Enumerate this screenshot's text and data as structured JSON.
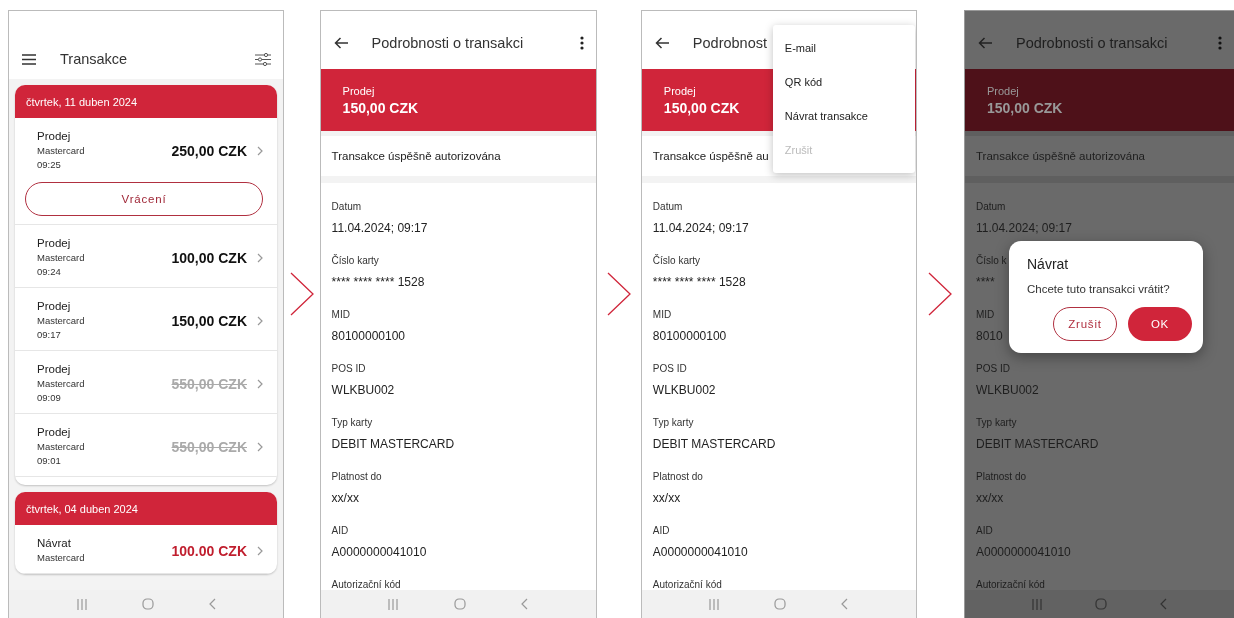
{
  "screens": [
    {
      "kind": "list",
      "title": "Transakce",
      "groups": [
        {
          "date": "čtvrtek, 11 duben 2024",
          "items": [
            {
              "type": "Prodej",
              "card": "Mastercard",
              "time": "09:25",
              "amount": "250,00 CZK",
              "kind": "sale",
              "voided": false,
              "action": "Vrácení"
            },
            {
              "type": "Prodej",
              "card": "Mastercard",
              "time": "09:24",
              "amount": "100,00 CZK",
              "kind": "sale",
              "voided": false
            },
            {
              "type": "Prodej",
              "card": "Mastercard",
              "time": "09:17",
              "amount": "150,00 CZK",
              "kind": "sale",
              "voided": false
            },
            {
              "type": "Prodej",
              "card": "Mastercard",
              "time": "09:09",
              "amount": "550,00 CZK",
              "kind": "sale",
              "voided": true
            },
            {
              "type": "Prodej",
              "card": "Mastercard",
              "time": "09:01",
              "amount": "550,00 CZK",
              "kind": "sale",
              "voided": true
            }
          ]
        },
        {
          "date": "čtvrtek, 04 duben 2024",
          "items": [
            {
              "type": "Návrat",
              "card": "Mastercard",
              "amount": "100.00 CZK",
              "kind": "refund",
              "voided": false
            }
          ]
        }
      ]
    },
    {
      "kind": "detail",
      "title": "Podrobnosti o transakci",
      "dimmed": false,
      "banner": {
        "type": "Prodej",
        "amount": "150,00 CZK"
      },
      "status": "Transakce úspěšně autorizována",
      "fields": [
        {
          "label": "Datum",
          "value": "11.04.2024; 09:17"
        },
        {
          "label": "Číslo karty",
          "value": "**** **** **** 1528"
        },
        {
          "label": "MID",
          "value": "80100000100"
        },
        {
          "label": "POS ID",
          "value": "WLKBU002"
        },
        {
          "label": "Typ karty",
          "value": "DEBIT MASTERCARD"
        },
        {
          "label": "Platnost do",
          "value": "xx/xx"
        },
        {
          "label": "AID",
          "value": "A0000000041010"
        },
        {
          "label": "Autorizační kód"
        }
      ]
    },
    {
      "kind": "detail",
      "title": "Podrobnost",
      "dimmed": false,
      "banner": {
        "type": "Prodej",
        "amount": "150,00 CZK"
      },
      "status": "Transakce úspěšně au",
      "fields": [
        {
          "label": "Datum",
          "value": "11.04.2024; 09:17"
        },
        {
          "label": "Číslo karty",
          "value": "**** **** **** 1528"
        },
        {
          "label": "MID",
          "value": "80100000100"
        },
        {
          "label": "POS ID",
          "value": "WLKBU002"
        },
        {
          "label": "Typ karty",
          "value": "DEBIT MASTERCARD"
        },
        {
          "label": "Platnost do",
          "value": "xx/xx"
        },
        {
          "label": "AID",
          "value": "A0000000041010"
        },
        {
          "label": "Autorizační kód"
        }
      ],
      "menu": [
        {
          "label": "E-mail",
          "disabled": false
        },
        {
          "label": "QR kód",
          "disabled": false
        },
        {
          "label": "Návrat transakce",
          "disabled": false
        },
        {
          "label": "Zrušit",
          "disabled": true
        }
      ]
    },
    {
      "kind": "detail",
      "title": "Podrobnosti o transakci",
      "dimmed": true,
      "banner": {
        "type": "Prodej",
        "amount": "150,00 CZK"
      },
      "status": "Transakce úspěšně autorizována",
      "fields": [
        {
          "label": "Datum",
          "value": "11.04.2024; 09:17"
        },
        {
          "label": "Číslo k",
          "value": "****"
        },
        {
          "label": "MID",
          "value": "8010"
        },
        {
          "label": "POS ID",
          "value": "WLKBU002"
        },
        {
          "label": "Typ karty",
          "value": "DEBIT MASTERCARD"
        },
        {
          "label": "Platnost do",
          "value": "xx/xx"
        },
        {
          "label": "AID",
          "value": "A0000000041010"
        },
        {
          "label": "Autorizační kód"
        }
      ],
      "dialog": {
        "title": "Návrat",
        "message": "Chcete tuto transakci vrátit?",
        "buttons": [
          {
            "label": "Zrušit",
            "kind": "outline"
          },
          {
            "label": "OK",
            "kind": "filled"
          }
        ]
      }
    }
  ]
}
